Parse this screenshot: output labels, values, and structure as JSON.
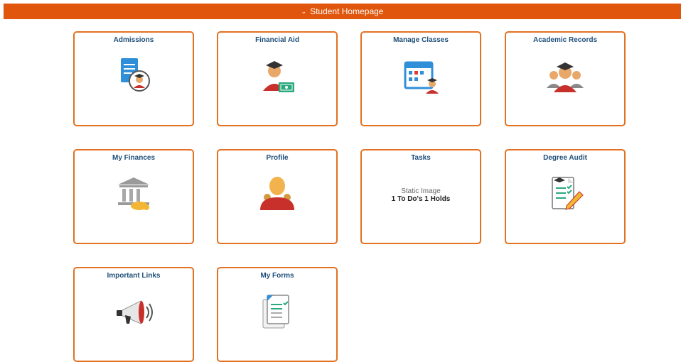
{
  "header": {
    "title": "Student Homepage",
    "chevron_icon": "chevron-down-icon"
  },
  "tiles": [
    {
      "title": "Admissions",
      "icon": "admissions-icon"
    },
    {
      "title": "Financial Aid",
      "icon": "financial-aid-icon"
    },
    {
      "title": "Manage Classes",
      "icon": "calendar-student-icon"
    },
    {
      "title": "Academic Records",
      "icon": "graduates-icon"
    },
    {
      "title": "My Finances",
      "icon": "bank-icon"
    },
    {
      "title": "Profile",
      "icon": "person-icon"
    },
    {
      "title": "Tasks",
      "image_alt": "Static Image",
      "summary": "1 To Do's 1 Holds"
    },
    {
      "title": "Degree Audit",
      "icon": "checklist-pencil-icon"
    },
    {
      "title": "Important Links",
      "icon": "megaphone-icon"
    },
    {
      "title": "My Forms",
      "icon": "forms-icon"
    }
  ],
  "colors": {
    "header_bg": "#e0560c",
    "tile_border": "#e37122",
    "title_text": "#1f4e79"
  }
}
